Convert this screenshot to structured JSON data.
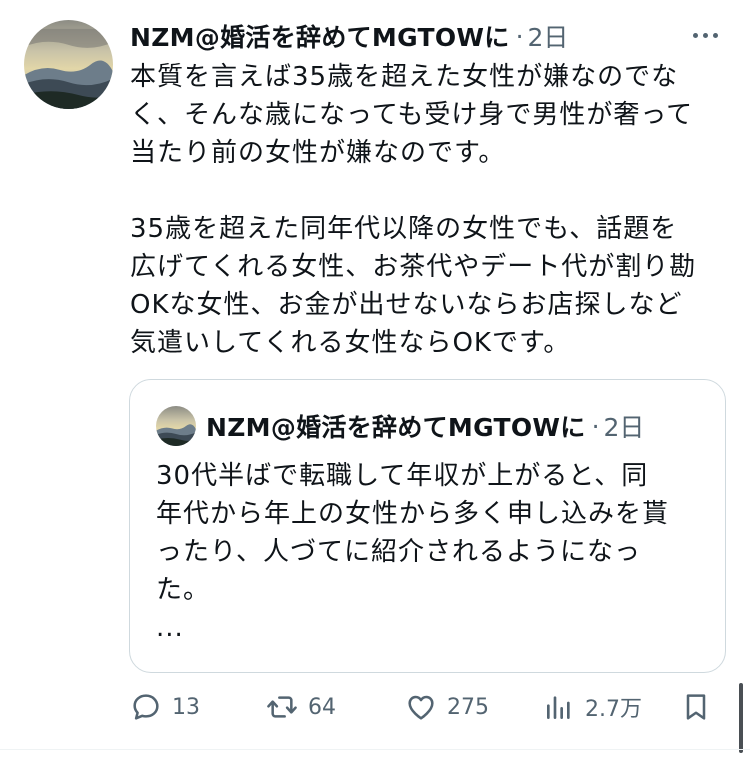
{
  "tweet": {
    "author_name": "NZM@婚活を辞めてMGTOWに",
    "separator": "·",
    "time": "2日",
    "body_lines": [
      "本質を言えば35歳を超えた女性が嫌なのでな",
      "く、そんな歳になっても受け身で男性が奢って",
      "当たり前の女性が嫌なのです。",
      "",
      "35歳を超えた同年代以降の女性でも、話題を",
      "広げてくれる女性、お茶代やデート代が割り勘",
      "OKな女性、お金が出せないならお店探しなど",
      "気遣いしてくれる女性ならOKです。"
    ]
  },
  "quote": {
    "author_name": "NZM@婚活を辞めてMGTOWに",
    "separator": "·",
    "time": "2日",
    "body_lines": [
      "30代半ばで転職して年収が上がると、同",
      "年代から年上の女性から多く申し込みを貰",
      "ったり、人づてに紹介されるようになっ",
      "た。",
      "..."
    ]
  },
  "actions": {
    "reply": {
      "icon": "reply-icon",
      "count": "13"
    },
    "retweet": {
      "icon": "retweet-icon",
      "count": "64"
    },
    "like": {
      "icon": "heart-icon",
      "count": "275"
    },
    "views": {
      "icon": "views-icon",
      "count": "2.7万"
    },
    "bookmark": {
      "icon": "bookmark-icon"
    }
  },
  "colors": {
    "text": "#0f1419",
    "secondary": "#536471",
    "border": "#cfd9de"
  }
}
